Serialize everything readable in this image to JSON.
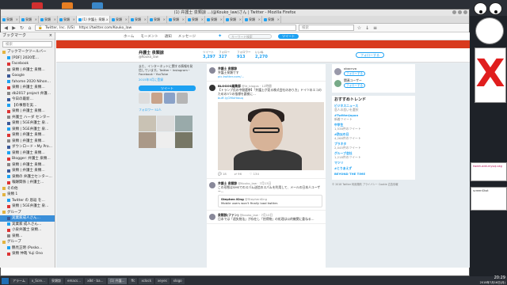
{
  "browser": {
    "window_title": "(1) 弁護士 泉類諒 …(@Kouko_law)さん | Twitter - Mozilla Firefox",
    "tabs": [
      {
        "label": "泉類"
      },
      {
        "label": "泉類"
      },
      {
        "label": "泉類"
      },
      {
        "label": "泉類"
      },
      {
        "label": "(1) 弁護士 泉類…",
        "active": true
      },
      {
        "label": "泉類"
      },
      {
        "label": "泉類"
      },
      {
        "label": "泉類"
      },
      {
        "label": "泉類"
      },
      {
        "label": "泉類"
      },
      {
        "label": "泉類"
      },
      {
        "label": "泉類"
      },
      {
        "label": "泉類"
      },
      {
        "label": "泉類"
      }
    ],
    "url": "https://twitter.com/Kouko_law",
    "url_site": "Twitter, Inc. (US)",
    "search_placeholder": "検索"
  },
  "sidebar": {
    "title": "ブックマーク",
    "search_placeholder": "検索",
    "items": [
      {
        "label": "ブックマークツールバー",
        "folder": true
      },
      {
        "label": "[PDF] 2020年…"
      },
      {
        "label": "Facebook"
      },
      {
        "label": "泉類 | 弁護士 泉類…"
      },
      {
        "label": "Google"
      },
      {
        "label": "fahome 2020 Nihon…"
      },
      {
        "label": "泉類 | 弁護士 泉類…"
      },
      {
        "label": "db2017 project 弁護…"
      },
      {
        "label": "今日の最新…"
      },
      {
        "label": "【の事態を実…"
      },
      {
        "label": "泉類 | 弁護士 泉類…"
      },
      {
        "label": "弁護士 ハーダ センター"
      },
      {
        "label": "泉類 | 5GE弁護士 泉…"
      },
      {
        "label": "泉類 | 5GE弁護士 泉…"
      },
      {
        "label": "泉類 | 弁護士 泉類…"
      },
      {
        "label": "泉類 | 弁護士 泉類…"
      },
      {
        "label": "ダウンロード・My Pro…"
      },
      {
        "label": "泉類 | 弁護士 泉類…"
      },
      {
        "label": "Blogger: 弁護士 泉類…"
      },
      {
        "label": "泉類 | 弁護士 泉類…"
      },
      {
        "label": "泉類 | 弁護士 泉類…"
      },
      {
        "label": "泉類の 弁護士センター…"
      },
      {
        "label": "報酬関係 | 弁護士…"
      },
      {
        "label": "その他",
        "folder": true
      },
      {
        "label": "泉類 1",
        "folder": true
      },
      {
        "label": "Twitter の 恩返 を…"
      },
      {
        "label": "泉類 | 5GE弁護士 泉…"
      },
      {
        "label": "グループ",
        "folder": true
      },
      {
        "label": "実業家成人さん…",
        "selected": true
      },
      {
        "label": "実業家 成人さん…"
      },
      {
        "label": "小泉弁護士 泉類…"
      },
      {
        "label": "泉類…"
      },
      {
        "label": "グループ",
        "folder": true
      },
      {
        "label": "鶴見正明 (Posko…"
      },
      {
        "label": "泉類 仲哉 Yuji Ono"
      }
    ]
  },
  "twitter": {
    "nav": {
      "home": "ホーム",
      "moments": "モーメント",
      "notifications": "通知",
      "messages": "メッセージ",
      "search_placeholder": "キーワード検索",
      "tweet": "ツイート"
    },
    "profile": {
      "name": "弁護士 泉類諒",
      "handle": "@Kouko_law",
      "bio": "また、インターネットに関する情報を発信しています。Twitter・Instagram・Facebook・YouTube",
      "joined": "2015年5月に登録",
      "tweet_button": "ツイート",
      "followers_you_know": "フォロワー 52人",
      "stats": [
        {
          "label": "ツイート",
          "value": "3,297"
        },
        {
          "label": "フォロー",
          "value": "327"
        },
        {
          "label": "フォロワー",
          "value": "913"
        },
        {
          "label": "いいね",
          "value": "2,270"
        }
      ],
      "follow_button": "フォローする"
    },
    "tweets": [
      {
        "name": "弁護士 泉類諒",
        "text": "弁護士泉類です",
        "link": "pic.twitter.com/…",
        "replies": "",
        "retweets": "",
        "likes": ""
      },
      {
        "name": "BLOGOS編集部",
        "handle": "@ld_blogos · 12時間",
        "text": "【トランプ氏の中間選挙】「弁護士が見る株式会社のあり方」ドイツのエコのための3つの指標を論拠に…",
        "link": "buff.ly/2MxHwuq",
        "replies": "18",
        "retweets": "96",
        "likes": "134"
      },
      {
        "name": "弁護士 泉類諒",
        "handle": "@Kouko_law · 7月13日",
        "text": "この形態はSMSでのスパム送信のスパムを利用して、メールの日本人ユーザー…",
        "quote_name": "Stephen King",
        "quote_handle": "@StephenKing",
        "quote_text": "Mobile users won't finally load twitter.",
        "replies": "",
        "retweets": "",
        "likes": ""
      },
      {
        "name": "泉類諒(ファン)",
        "handle": "@kouko_law · 7月10日",
        "text": "日本では「遺失物法」が存在し「拾得物」の処理は公的機関に委ねる…",
        "replies": "",
        "retweets": "",
        "likes": ""
      }
    ],
    "suggestions_title": "おすすめユーザー",
    "suggestions": [
      {
        "name": "obocnva",
        "follow": "フォローする"
      },
      {
        "name": "関連ユーザー",
        "follow": "フォローする"
      }
    ],
    "trends_title": "おすすめトレンド",
    "trends": [
      {
        "tag": "ビジネスニュース",
        "count": "恋人の恋いを選択"
      },
      {
        "tag": "#TwitterJapan",
        "count": "新着ツイート"
      },
      {
        "tag": "中学生",
        "count": "1,538件のツイート"
      },
      {
        "tag": "#防災の日",
        "count": "4,268件のツイート"
      },
      {
        "tag": "プラネタ",
        "count": "2,045件のツイート"
      },
      {
        "tag": "グループ会社",
        "count": "1,218件のツイート"
      },
      {
        "tag": "マツリ",
        "count": ""
      },
      {
        "tag": "#とりあえず",
        "count": ""
      },
      {
        "tag": "BEYOND THE TIME",
        "count": ""
      }
    ],
    "footer": "© 2018 Twitter 利用規約 プライバシー Cookie 広告情報"
  },
  "desktop": {
    "widgets": [
      {
        "name": "firefox-log",
        "text": "tweet-add-mysql-skg"
      },
      {
        "name": "screenshot",
        "text": "screenShot"
      }
    ]
  },
  "taskbar": {
    "items": [
      {
        "label": "アラーム"
      },
      {
        "label": "x_Scre…"
      },
      {
        "label": "泉類諒"
      },
      {
        "label": "emacs…"
      },
      {
        "label": "x8d - ba…"
      },
      {
        "label": "(1) 弁護…",
        "active": true
      },
      {
        "label": "ffc"
      },
      {
        "label": "xclock"
      },
      {
        "label": "xeyes"
      },
      {
        "label": "xlogo"
      }
    ],
    "clock_time": "20:29",
    "clock_date": "2018年7月16日(月)"
  },
  "colors": {
    "twitter_blue": "#1da1f2",
    "banner_red": "#d83a1e",
    "x_red": "#e01e1e"
  }
}
